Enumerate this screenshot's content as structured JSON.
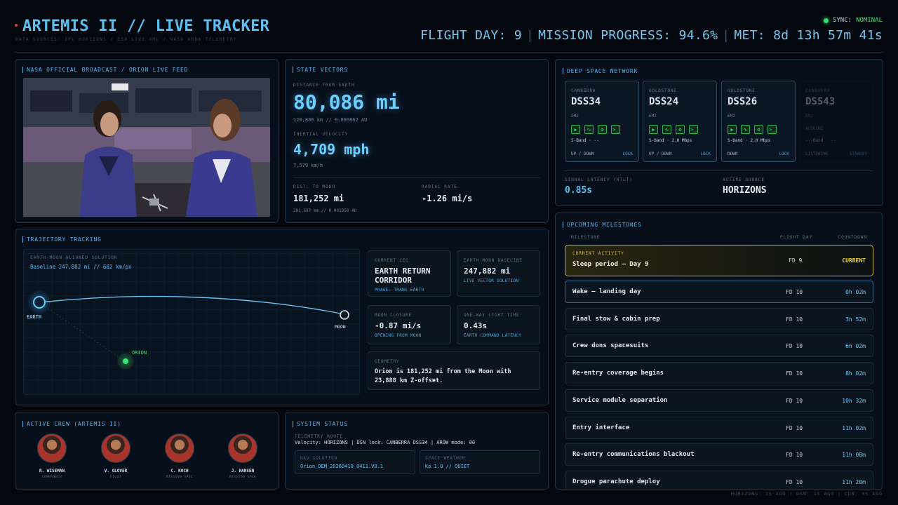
{
  "header": {
    "title": "ARTEMIS II // LIVE TRACKER",
    "sources": "DATA SOURCES: JPL HORIZONS / DSN LIVE XML / NASA AROW TELEMETRY",
    "sync_label": "SYNC:",
    "sync_value": "NOMINAL",
    "flight_day": "FLIGHT DAY: 9",
    "mission_progress": "MISSION PROGRESS: 94.6%",
    "met": "MET: 8d 13h 57m 41s",
    "sep": "|"
  },
  "broadcast": {
    "title": "NASA OFFICIAL BROADCAST / ORION LIVE FEED"
  },
  "state_vectors": {
    "title": "STATE VECTORS",
    "distance_label": "DISTANCE FROM EARTH",
    "distance_value": "80,086 mi",
    "distance_sub": "128,886 km // 0.000862 AU",
    "velocity_label": "INERTIAL VELOCITY",
    "velocity_value": "4,709 mph",
    "velocity_sub": "7,579 km/h",
    "moon_label": "DIST. TO MOON",
    "moon_value": "181,252 mi",
    "moon_sub": "291,697 km // 0.001950 AU",
    "radial_label": "RADIAL RATE",
    "radial_value": "-1.26 mi/s"
  },
  "dsn": {
    "title": "DEEP SPACE NETWORK",
    "stations": [
      {
        "location": "CANBERRA",
        "name": "DSS34",
        "spacecraft": "EM2",
        "band": "S-Band · --",
        "direction": "UP / DOWN",
        "status": "LOCK"
      },
      {
        "location": "GOLDSTONE",
        "name": "DSS24",
        "spacecraft": "EM2",
        "band": "S-Band · 2.0 Mbps",
        "direction": "UP / DOWN",
        "status": "LOCK"
      },
      {
        "location": "GOLDSTONE",
        "name": "DSS26",
        "spacecraft": "EM2",
        "band": "S-Band · 2.0 Mbps",
        "direction": "DOWN",
        "status": "LOCK"
      },
      {
        "location": "CANBERRA",
        "name": "DSS43",
        "spacecraft": "EM2",
        "extra": "ACQUIRE",
        "band": "---Band · --",
        "direction": "LISTENING",
        "status": "STANDBY"
      }
    ],
    "latency_label": "SIGNAL LATENCY (RTLT)",
    "latency_value": "0.85s",
    "source_label": "ACTIVE SOURCE",
    "source_value": "HORIZONS",
    "icons": [
      "play-icon",
      "waveform-icon",
      "gear-icon",
      "terminal-icon"
    ],
    "icon_glyphs": [
      "▶",
      "∿",
      "⚙",
      ">_"
    ]
  },
  "trajectory": {
    "title": "TRAJECTORY TRACKING",
    "solution_label": "EARTH-MOON ALIGNED SOLUTION",
    "baseline": "Baseline 247,882 mi // 682 km/px",
    "earth_label": "EARTH",
    "moon_label": "MOON",
    "orion_label": "ORION",
    "cards": {
      "leg_label": "CURRENT LEG",
      "leg_value_1": "EARTH RETURN",
      "leg_value_2": "CORRIDOR",
      "leg_sub": "PHASE: TRANS-EARTH",
      "baseline_label": "EARTH-MOON BASELINE",
      "baseline_value": "247,882 mi",
      "baseline_sub": "LIVE VECTOR SOLUTION",
      "closure_label": "MOON CLOSURE",
      "closure_value": "-0.87 mi/s",
      "closure_sub": "OPENING FROM MOON",
      "light_label": "ONE-WAY LIGHT TIME",
      "light_value": "0.43s",
      "light_sub": "EARTH COMMAND LATENCY",
      "geometry_label": "GEOMETRY",
      "geometry_line_1": "Orion is 181,252 mi from the Moon with",
      "geometry_line_2": "23,888 km Z-offset."
    }
  },
  "crew": {
    "title": "ACTIVE CREW (ARTEMIS II)",
    "members": [
      {
        "name": "R. WISEMAN",
        "role": "COMMANDER"
      },
      {
        "name": "V. GLOVER",
        "role": "PILOT"
      },
      {
        "name": "C. KOCH",
        "role": "MISSION SPEC"
      },
      {
        "name": "J. HANSEN",
        "role": "MISSION SPEC"
      }
    ]
  },
  "system": {
    "title": "SYSTEM STATUS",
    "route_label": "TELEMETRY ROUTE",
    "route_value": "Velocity: HORIZONS | DSN lock: CANBERRA DSS34 | AROW mode: 00",
    "nav_label": "NAV SOLUTION",
    "nav_value": "Orion_OEM_20260410_0411.V0.1",
    "weather_label": "SPACE WEATHER",
    "weather_value": "Kp 1.0 // QUIET"
  },
  "milestones": {
    "title": "UPCOMING MILESTONES",
    "col_milestone": "MILESTONE",
    "col_day": "FLIGHT DAY",
    "col_countdown": "COUNTDOWN",
    "current": {
      "tag": "CURRENT ACTIVITY",
      "name": "Sleep period — Day 9",
      "day": "FD 9",
      "countdown": "CURRENT"
    },
    "items": [
      {
        "name": "Wake — landing day",
        "day": "FD 10",
        "countdown": "0h 02m"
      },
      {
        "name": "Final stow & cabin prep",
        "day": "FD 10",
        "countdown": "3h 52m"
      },
      {
        "name": "Crew dons spacesuits",
        "day": "FD 10",
        "countdown": "6h 02m"
      },
      {
        "name": "Re-entry coverage begins",
        "day": "FD 10",
        "countdown": "8h 02m"
      },
      {
        "name": "Service module separation",
        "day": "FD 10",
        "countdown": "10h 32m"
      },
      {
        "name": "Entry interface",
        "day": "FD 10",
        "countdown": "11h 02m"
      },
      {
        "name": "Re-entry communications blackout",
        "day": "FD 10",
        "countdown": "11h 08m"
      },
      {
        "name": "Drogue parachute deploy",
        "day": "FD 10",
        "countdown": "11h 20m"
      }
    ]
  },
  "footer": {
    "text": "HORIZONS: 15 AGO | DSN: 15 AGO | CDN: 0S AGO"
  },
  "colors": {
    "accent": "#5cc0f2",
    "ok": "#36d96a",
    "current": "#c8b33a"
  }
}
